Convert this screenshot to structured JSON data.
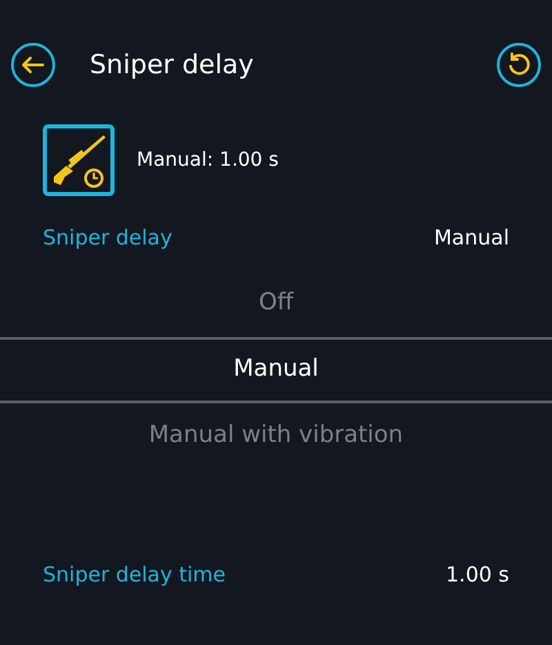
{
  "header": {
    "title": "Sniper delay"
  },
  "summary": {
    "text": "Manual: 1.00 s"
  },
  "setting": {
    "label": "Sniper delay",
    "value": "Manual"
  },
  "options": [
    {
      "label": "Off",
      "selected": false
    },
    {
      "label": "Manual",
      "selected": true
    },
    {
      "label": "Manual with vibration",
      "selected": false
    }
  ],
  "delay_time": {
    "label": "Sniper delay time",
    "value": "1.00 s"
  }
}
